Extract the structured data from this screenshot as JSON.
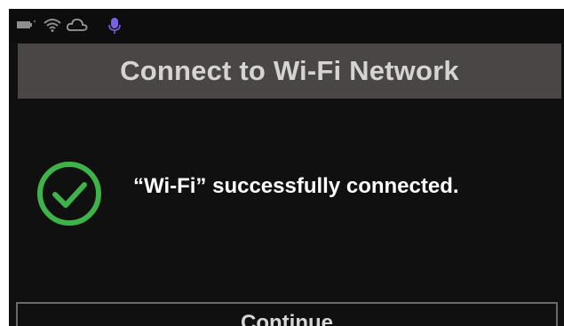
{
  "status_bar": {
    "icons": [
      "battery-icon",
      "wifi-icon",
      "cloud-icon",
      "microphone-icon"
    ]
  },
  "header": {
    "title": "Connect to Wi-Fi Network"
  },
  "main": {
    "status_icon": "check-circle-icon",
    "message": "“Wi-Fi” successfully connected."
  },
  "footer": {
    "continue_label": "Continue"
  },
  "colors": {
    "background": "#101010",
    "title_bar": "#4a4645",
    "success_green": "#3db34a",
    "microphone_purple": "#7b5fe0"
  }
}
